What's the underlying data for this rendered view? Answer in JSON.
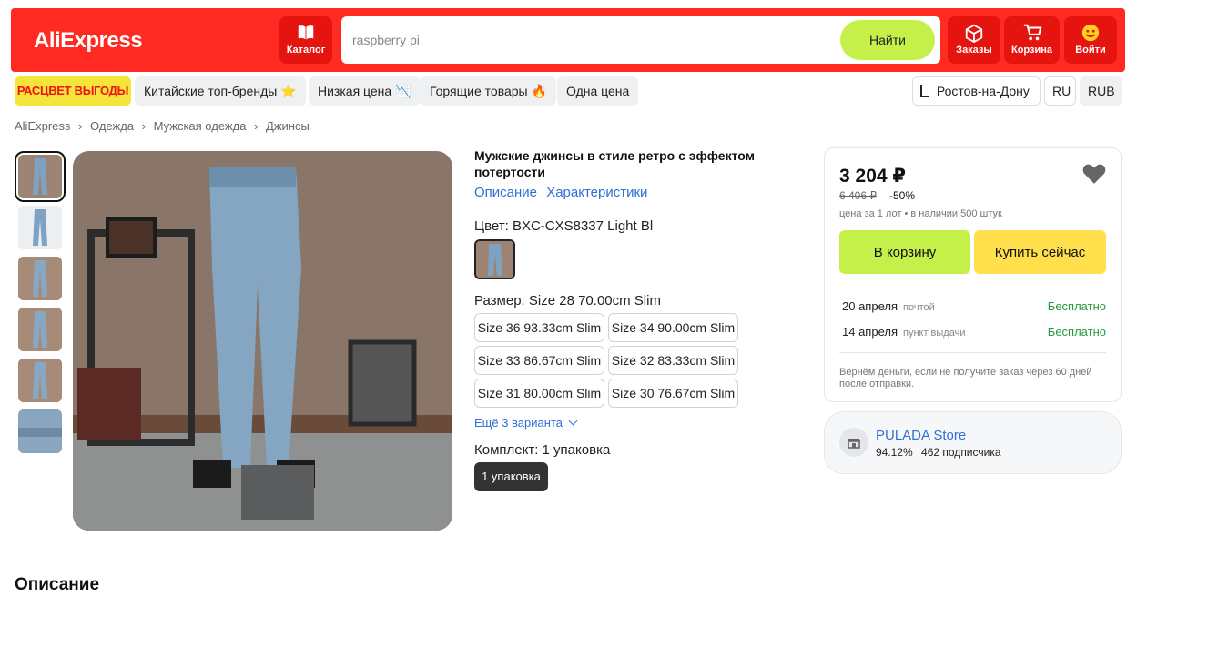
{
  "header": {
    "logo": "AliExpress",
    "catalog_label": "Каталог",
    "search_value": "raspberry pi",
    "search_button": "Найти",
    "orders_label": "Заказы",
    "cart_label": "Корзина",
    "login_label": "Войти",
    "brand_color": "#ff2a22"
  },
  "promo_bar": {
    "promo_label": "РАСЦВЕТ ВЫГОДЫ",
    "chips": [
      "Китайские топ-бренды ⭐",
      "Низкая цена 📉",
      "Горящие товары 🔥",
      "Одна цена"
    ],
    "location": "Ростов-на-Дону",
    "language": "RU",
    "currency": "RUB"
  },
  "breadcrumb": [
    "AliExpress",
    "Одежда",
    "Мужская одежда",
    "Джинсы"
  ],
  "product": {
    "title": "Мужские джинсы в стиле ретро с эффектом потертости",
    "tab_description": "Описание",
    "tab_specs": "Характеристики",
    "color_label": "Цвет: BXC-CXS8337 Light Bl",
    "size_label": "Размер: Size 28 70.00cm Slim",
    "sizes": [
      "Size 36 93.33cm Slim",
      "Size 34 90.00cm Slim",
      "Size 33 86.67cm Slim",
      "Size 32 83.33cm Slim",
      "Size 31 80.00cm Slim",
      "Size 30 76.67cm Slim"
    ],
    "more_variants": "Ещё 3 варианта",
    "bundle_label": "Комплект: 1 упаковка",
    "bundle_option": "1 упаковка"
  },
  "buybox": {
    "price": "3 204 ₽",
    "old_price": "6 406 ₽",
    "discount": "-50%",
    "stock_note": "цена за 1 лот • в наличии 500 штук",
    "add_to_cart": "В корзину",
    "buy_now": "Купить сейчас",
    "delivery": [
      {
        "date": "20 апреля",
        "method": "почтой",
        "cost": "Бесплатно"
      },
      {
        "date": "14 апреля",
        "method": "пункт выдачи",
        "cost": "Бесплатно"
      }
    ],
    "refund_note": "Вернём деньги, если не получите заказ через 60 дней после отправки."
  },
  "store": {
    "name": "PULADA Store",
    "rating": "94.12%",
    "followers": "462 подписчика"
  },
  "section_title": "Описание"
}
